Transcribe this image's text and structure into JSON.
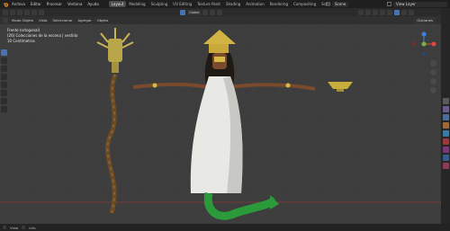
{
  "topbar": {
    "menus": [
      "Archivo",
      "Editar",
      "Procesar",
      "Ventana",
      "Ayuda"
    ],
    "workspaces": [
      "Layout",
      "Modeling",
      "Sculpting",
      "UV Editing",
      "Texture Paint",
      "Shading",
      "Animation",
      "Rendering",
      "Compositing",
      "Scri"
    ],
    "active_workspace": "Layout",
    "scene_label": "Scene",
    "view_layer_label": "View Layer"
  },
  "toolbar": {
    "orientation_label": "Global",
    "options_label": "Opciones"
  },
  "modebar": {
    "mode_label": "Modo Objeto",
    "items": [
      "Vista",
      "Seleccionar",
      "Agregar",
      "Objeto"
    ]
  },
  "viewport": {
    "overlay_lines": [
      "Frente (ortogonal)",
      "(26) Colecciones de la escena | vestido",
      "10 Centímetros"
    ]
  },
  "statusbar": {
    "items": [
      "Vista",
      "Info"
    ]
  },
  "icons": {
    "logo": "blender-logo-icon",
    "gizmo_x": "#e0473c",
    "gizmo_y": "#77b244",
    "gizmo_z": "#3e7fe0"
  }
}
